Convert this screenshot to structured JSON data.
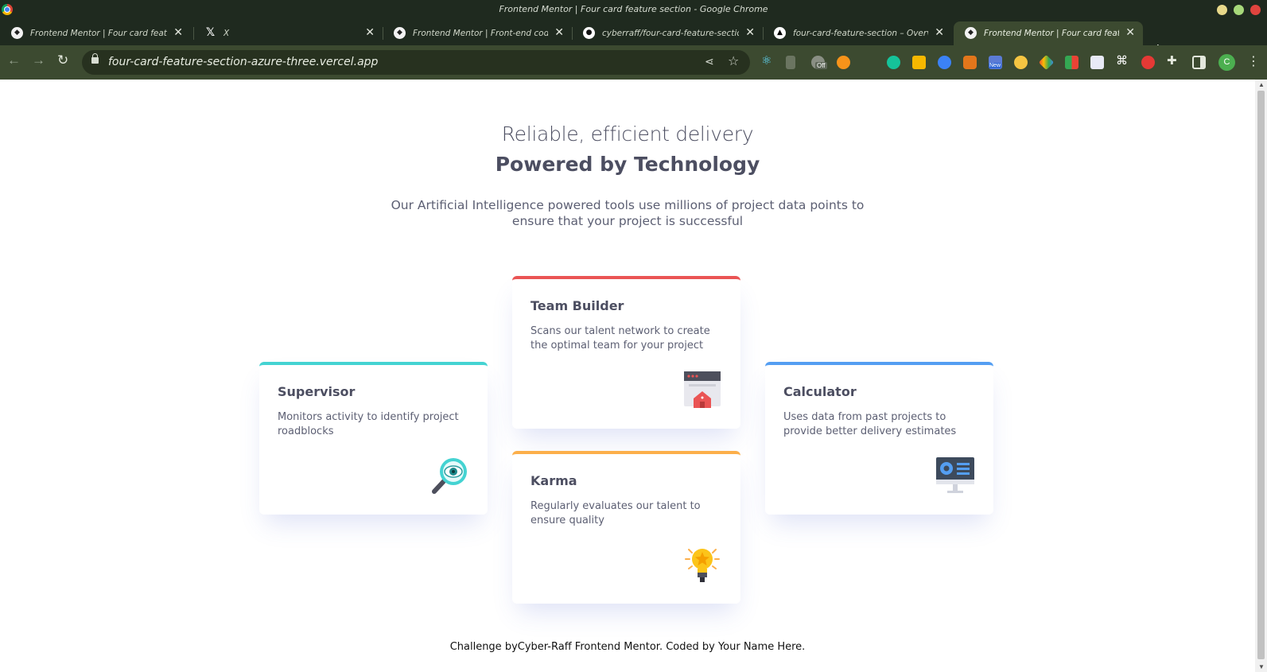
{
  "window": {
    "title": "Frontend Mentor | Four card feature section - Google Chrome"
  },
  "tabs": [
    {
      "label": "Frontend Mentor | Four card feature section",
      "icon": "frontend-mentor-icon"
    },
    {
      "label": "X",
      "icon": "x-icon"
    },
    {
      "label": "Frontend Mentor | Front-end coding challenges",
      "icon": "frontend-mentor-icon"
    },
    {
      "label": "cyberraff/four-card-feature-section: This is",
      "icon": "github-icon"
    },
    {
      "label": "four-card-feature-section – Overview - Vercel",
      "icon": "vercel-icon"
    },
    {
      "label": "Frontend Mentor | Four card feature section",
      "icon": "frontend-mentor-icon",
      "active": true
    }
  ],
  "toolbar": {
    "url": "four-card-feature-section-azure-three.vercel.app",
    "profile_initial": "C",
    "extension_badges": {
      "off": "Off",
      "new": "New"
    }
  },
  "page": {
    "subtitle": "Reliable, efficient delivery",
    "heading": "Powered by Technology",
    "description": "Our Artificial Intelligence powered tools use millions of project data points to ensure that your project is successful",
    "cards": {
      "supervisor": {
        "title": "Supervisor",
        "text": "Monitors activity to identify project roadblocks",
        "icon": "magnifier-eye-icon",
        "accent": "#44d3d2"
      },
      "team_builder": {
        "title": "Team Builder",
        "text": "Scans our talent network to create the optimal team for your project",
        "icon": "team-builder-icon",
        "accent": "#ea5454"
      },
      "karma": {
        "title": "Karma",
        "text": "Regularly evaluates our talent to ensure quality",
        "icon": "lightbulb-icon",
        "accent": "#fcaf4a"
      },
      "calculator": {
        "title": "Calculator",
        "text": "Uses data from past projects to provide better delivery estimates",
        "icon": "monitor-calculator-icon",
        "accent": "#549ef2"
      }
    },
    "footer": "Challenge byCyber-Raff Frontend Mentor. Coded by Your Name Here."
  }
}
